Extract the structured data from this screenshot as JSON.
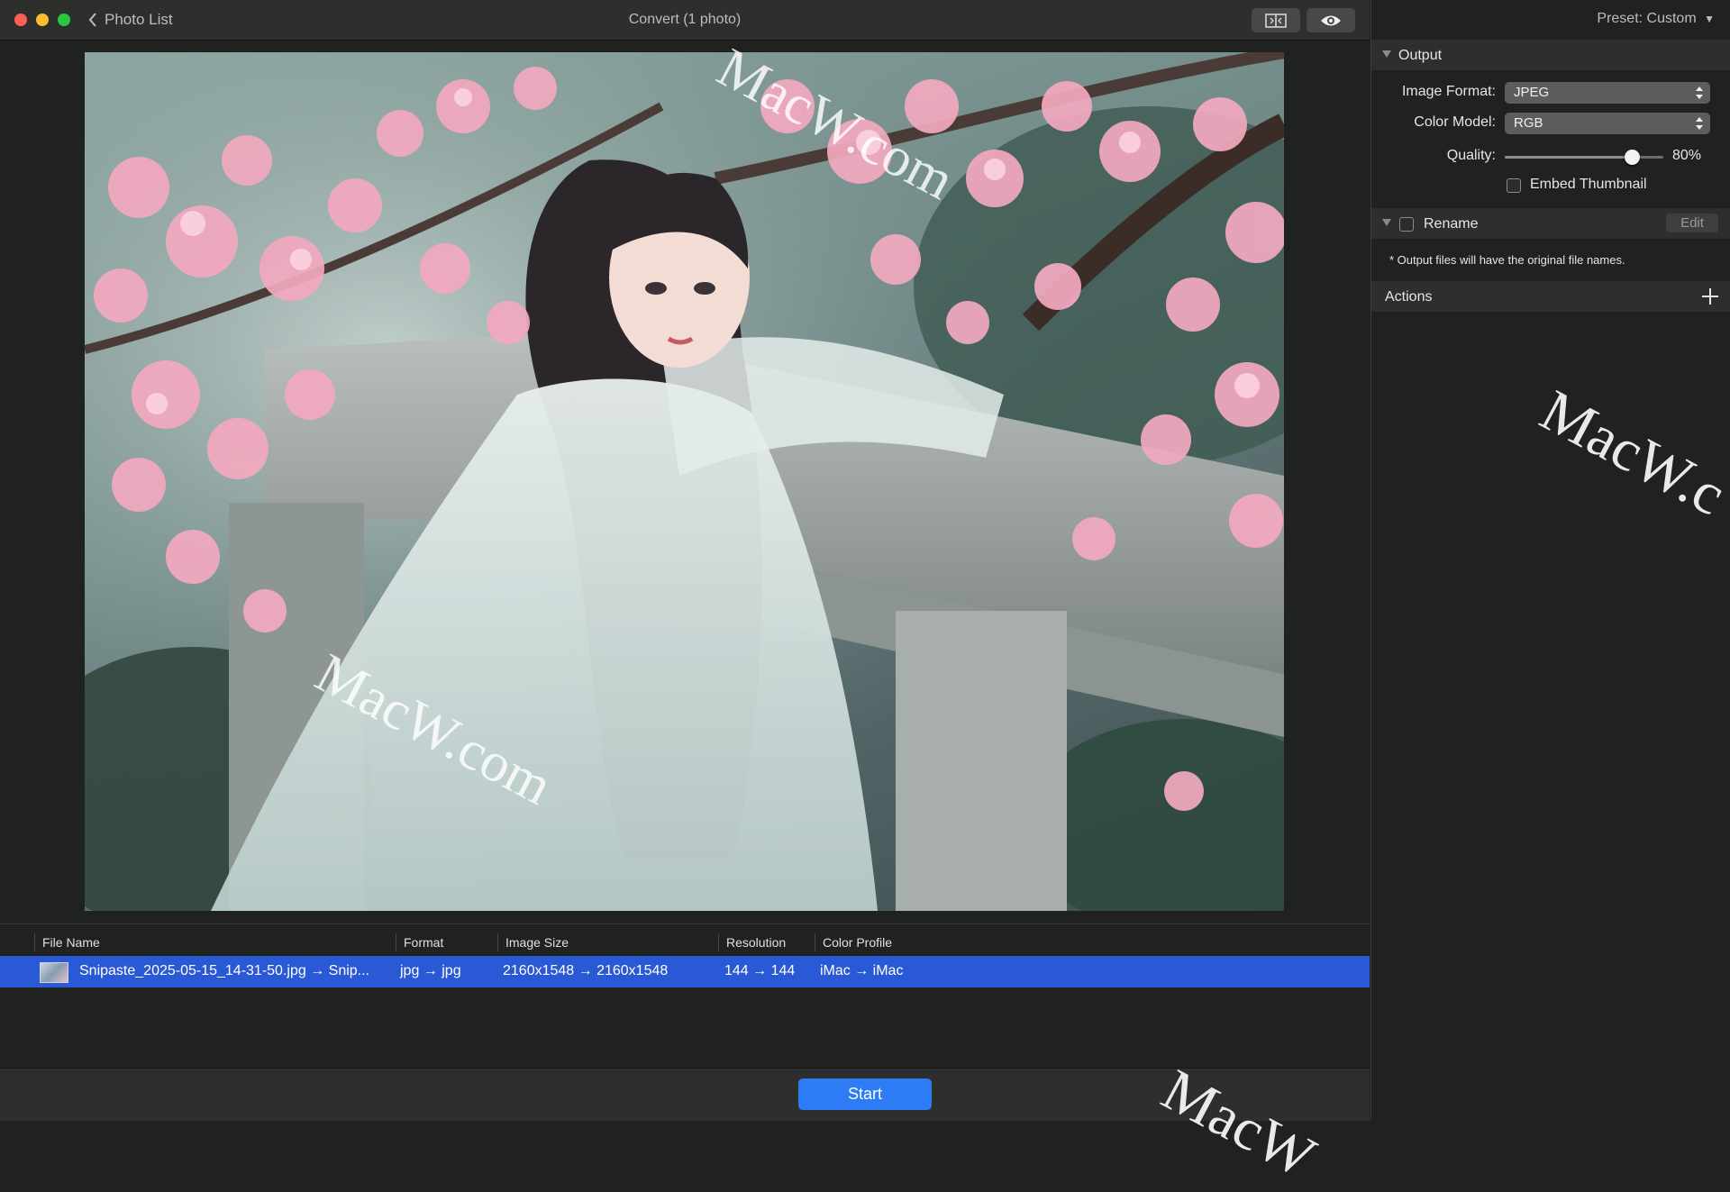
{
  "window": {
    "title": "Convert (1 photo)",
    "back_label": "Photo List"
  },
  "table": {
    "headers": [
      "File Name",
      "Format",
      "Image Size",
      "Resolution",
      "Color Profile"
    ],
    "row": {
      "file_name": "Snipaste_2025-05-15_14-31-50.jpg → Snip...",
      "format": "jpg → jpg",
      "image_size": "2160x1548 → 2160x1548",
      "resolution": "144 → 144",
      "color_profile": "iMac → iMac"
    }
  },
  "start_label": "Start",
  "panel": {
    "preset": "Preset: Custom",
    "output": {
      "title": "Output",
      "image_format_label": "Image Format:",
      "image_format_value": "JPEG",
      "color_model_label": "Color Model:",
      "color_model_value": "RGB",
      "quality_label": "Quality:",
      "quality_value": "80%",
      "quality_fraction": 0.8,
      "embed_thumbnail_label": "Embed Thumbnail",
      "embed_thumbnail_checked": false
    },
    "rename": {
      "title": "Rename",
      "checked": false,
      "edit_label": "Edit",
      "note": "* Output files will have the original file names."
    },
    "actions": {
      "title": "Actions"
    }
  },
  "watermarks": [
    "MacW.com",
    "MacW.com",
    "MacW.c",
    "MacW"
  ],
  "colors": {
    "accent": "#2d7cf6",
    "selection": "#2a59d6",
    "background": "#1f221e",
    "toolbar": "#2c2f2b"
  }
}
